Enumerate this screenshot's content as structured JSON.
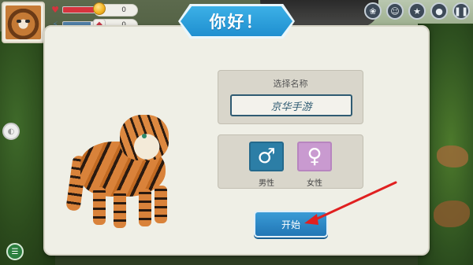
{
  "hud": {
    "health_fill": 0.85,
    "energy_fill": 0.75,
    "coins": "0",
    "meat": "0"
  },
  "dialog": {
    "title": "你好！",
    "name_section": {
      "label": "选择名称",
      "value": "京华手游"
    },
    "gender": {
      "male_label": "男性",
      "female_label": "女性",
      "male_symbol": "♂",
      "female_symbol": "♀"
    },
    "start_label": "开始"
  },
  "colors": {
    "health": "#d6343e",
    "energy": "#4f7fa8",
    "title_blue": "#2ba0dc",
    "male": "#2c7ea6",
    "female": "#c99ad0",
    "start": "#2a87c5",
    "arrow": "#e02020"
  },
  "icons": {
    "top_buttons": [
      "paw-icon",
      "mask-icon",
      "star-icon",
      "location-icon",
      "pause-icon"
    ]
  }
}
